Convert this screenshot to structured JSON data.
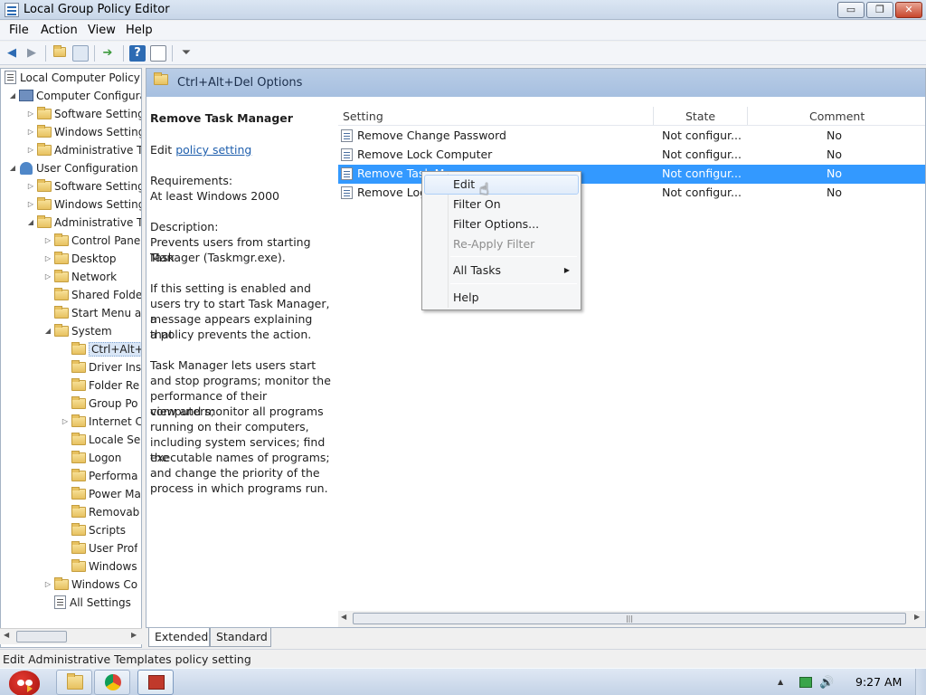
{
  "window": {
    "title": "Local Group Policy Editor",
    "controls": {
      "minimize": "▭",
      "maximize": "❐",
      "close": "✕"
    }
  },
  "menu": [
    "File",
    "Action",
    "View",
    "Help"
  ],
  "toolbar": {
    "icons": [
      "back-icon",
      "forward-icon",
      "up-folder-icon",
      "show-hide-tree-icon",
      "export-list-icon",
      "help-icon",
      "properties-icon",
      "filter-icon"
    ]
  },
  "tree": {
    "items": [
      {
        "label": "Local Computer Policy"
      },
      {
        "label": "Computer Configura"
      },
      {
        "label": "Software Setting"
      },
      {
        "label": "Windows Setting"
      },
      {
        "label": "Administrative Te"
      },
      {
        "label": "User Configuration"
      },
      {
        "label": "Software Setting"
      },
      {
        "label": "Windows Setting"
      },
      {
        "label": "Administrative Te"
      },
      {
        "label": "Control Pane"
      },
      {
        "label": "Desktop"
      },
      {
        "label": "Network"
      },
      {
        "label": "Shared Folde"
      },
      {
        "label": "Start Menu ar"
      },
      {
        "label": "System"
      },
      {
        "label": "Ctrl+Alt+D"
      },
      {
        "label": "Driver Ins"
      },
      {
        "label": "Folder Re"
      },
      {
        "label": "Group Po"
      },
      {
        "label": "Internet C"
      },
      {
        "label": "Locale Se"
      },
      {
        "label": "Logon"
      },
      {
        "label": "Performa"
      },
      {
        "label": "Power Ma"
      },
      {
        "label": "Removab"
      },
      {
        "label": "Scripts"
      },
      {
        "label": "User Prof"
      },
      {
        "label": "Windows"
      },
      {
        "label": "Windows Co"
      },
      {
        "label": "All Settings"
      }
    ]
  },
  "header": {
    "path": "Ctrl+Alt+Del Options"
  },
  "description": {
    "title": "Remove Task Manager",
    "edit_prefix": "Edit",
    "edit_link": "policy setting",
    "requirements_label": "Requirements:",
    "requirements": "At least Windows 2000",
    "description_label": "Description:",
    "desc_line1": "Prevents users from starting Task",
    "desc_line2": "Manager (Taskmgr.exe).",
    "p2_l1": "If this setting is enabled and",
    "p2_l2": "users try to start Task Manager, a",
    "p2_l3": "message appears explaining that",
    "p2_l4": "a policy prevents the action.",
    "p3_l1": "Task Manager lets users start",
    "p3_l2": "and stop programs; monitor the",
    "p3_l3": "performance of their computers;",
    "p3_l4": "view and monitor all programs",
    "p3_l5": "running on their computers,",
    "p3_l6": "including system services; find the",
    "p3_l7": "executable names of programs;",
    "p3_l8": "and change the priority of the",
    "p3_l9": "process in which programs run."
  },
  "list": {
    "columns": [
      "Setting",
      "State",
      "Comment"
    ],
    "rows": [
      {
        "setting": "Remove Change Password",
        "state": "Not configur...",
        "comment": "No"
      },
      {
        "setting": "Remove Lock Computer",
        "state": "Not configur...",
        "comment": "No"
      },
      {
        "setting": "Remove Task Manager",
        "state": "Not configur...",
        "comment": "No",
        "visible_setting": "Remove Task M"
      },
      {
        "setting": "Remove Logoff",
        "state": "Not configur...",
        "comment": "No",
        "visible_setting": "Remove Log"
      }
    ]
  },
  "context_menu": {
    "items": [
      "Edit",
      "Filter On",
      "Filter Options...",
      "Re-Apply Filter",
      "All Tasks",
      "Help"
    ]
  },
  "tabs": [
    "Extended",
    "Standard"
  ],
  "status": "Edit Administrative Templates policy setting",
  "taskbar": {
    "clock": "9:27 AM",
    "buttons": [
      "explorer-icon",
      "chrome-icon",
      "gpedit-icon"
    ]
  },
  "colors": {
    "selection": "#3399ff",
    "link": "#1f5fad",
    "header": "#b9cde6"
  }
}
